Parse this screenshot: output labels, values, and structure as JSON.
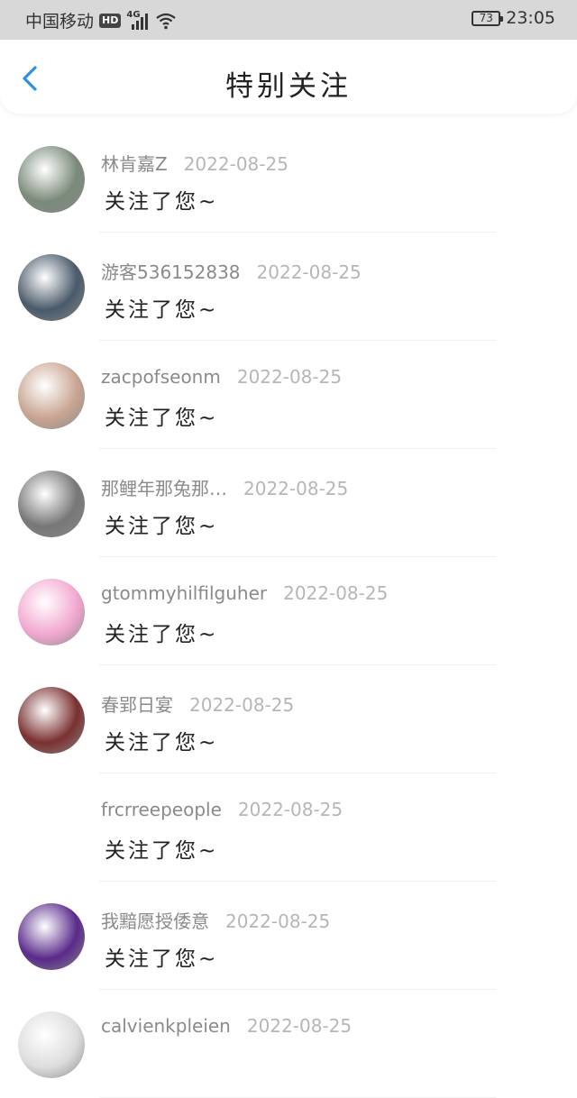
{
  "status_bar": {
    "carrier": "中国移动",
    "hd": "HD",
    "network": "4G",
    "battery": "73",
    "time": "23:05"
  },
  "header": {
    "title": "特别关注"
  },
  "followers": [
    {
      "name": "林肯嘉Z",
      "date": "2022-08-25",
      "message": "关注了您~",
      "avatar_color": "#7a8a7a"
    },
    {
      "name": "游客536152838",
      "date": "2022-08-25",
      "message": "关注了您~",
      "avatar_color": "#4a5a6a"
    },
    {
      "name": "zacpofseonm",
      "date": "2022-08-25",
      "message": "关注了您~",
      "avatar_color": "#c9a592"
    },
    {
      "name": "那鲤年那兔那…",
      "date": "2022-08-25",
      "message": "关注了您~",
      "avatar_color": "#777777"
    },
    {
      "name": "gtommyhilfilguher",
      "date": "2022-08-25",
      "message": "关注了您~",
      "avatar_color": "#f2a8d0"
    },
    {
      "name": "春郢日宴",
      "date": "2022-08-25",
      "message": "关注了您~",
      "avatar_color": "#7a3030"
    },
    {
      "name": "frcrreepeople",
      "date": "2022-08-25",
      "message": "关注了您~",
      "avatar_color": ""
    },
    {
      "name": "我黯愿授倭意",
      "date": "2022-08-25",
      "message": "关注了您~",
      "avatar_color": "#5a2a8a"
    },
    {
      "name": "calvienkpleien",
      "date": "2022-08-25",
      "message": "",
      "avatar_color": "#dddddd"
    }
  ]
}
